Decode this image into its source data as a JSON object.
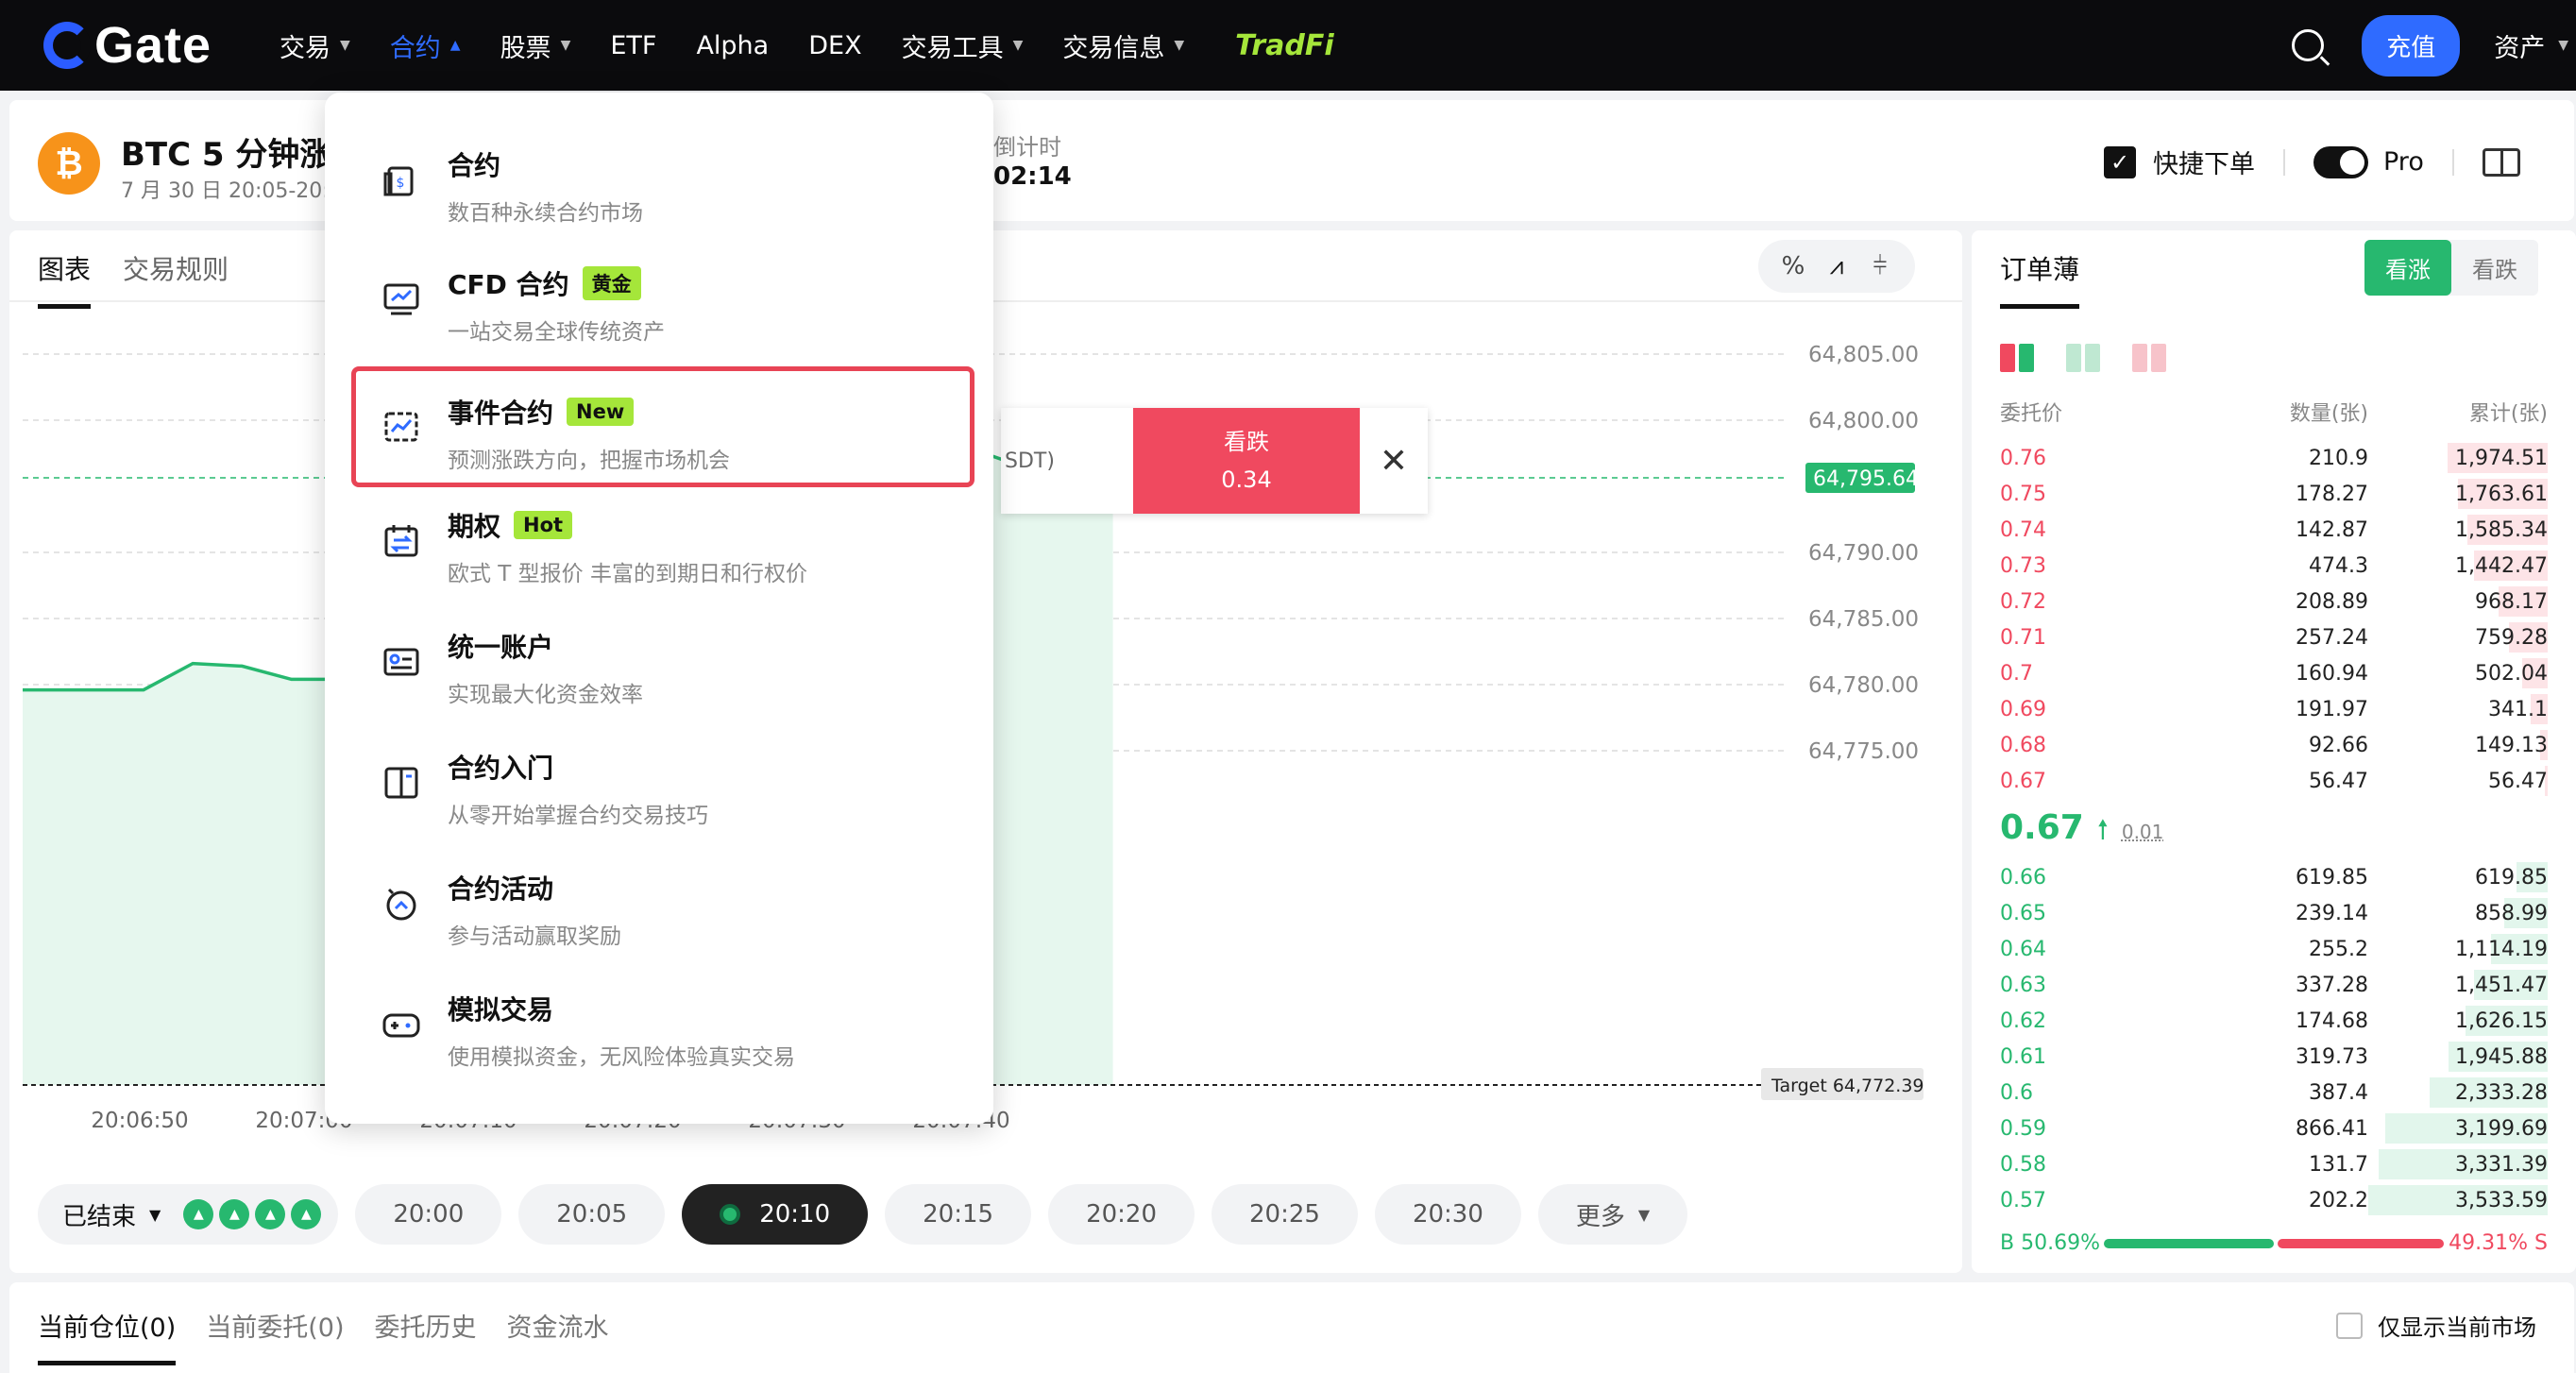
{
  "nav": {
    "logo": "Gate",
    "items": [
      {
        "label": "交易",
        "caret": true,
        "active": false
      },
      {
        "label": "合约",
        "caret": true,
        "active": true
      },
      {
        "label": "股票",
        "caret": true,
        "active": false
      },
      {
        "label": "ETF",
        "caret": false,
        "active": false
      },
      {
        "label": "Alpha",
        "caret": false,
        "active": false
      },
      {
        "label": "DEX",
        "caret": false,
        "active": false
      },
      {
        "label": "交易工具",
        "caret": true,
        "active": false
      },
      {
        "label": "交易信息",
        "caret": true,
        "active": false
      }
    ],
    "tradfi": "TradFi",
    "deposit": "充值",
    "assets": "资产"
  },
  "header": {
    "title": "BTC 5 分钟涨",
    "subtitle": "7 月 30 日 20:05-20:",
    "countdown_label": "倒计时",
    "countdown_value": "02:14",
    "quick_order": "快捷下单",
    "pro": "Pro"
  },
  "chart_panel": {
    "tabs": [
      "图表",
      "交易规则"
    ],
    "popup": {
      "left_text": "SDT)",
      "sell_label": "看跌",
      "sell_value": "0.34"
    },
    "y_ticks": [
      "64,805.00",
      "64,800.00",
      "64,795.64",
      "64,790.00",
      "64,785.00",
      "64,780.00",
      "64,775.00"
    ],
    "target_label": "Target 64,772.39",
    "x_ticks": [
      "20:06:50",
      "20:07:00",
      "20:07:10",
      "20:07:20",
      "20:07:30",
      "20:07:40"
    ],
    "ended_label": "已结束",
    "rounds": [
      "20:00",
      "20:05",
      "20:10",
      "20:15",
      "20:20",
      "20:25",
      "20:30"
    ],
    "active_round": "20:10",
    "more": "更多"
  },
  "chart_data": {
    "type": "area",
    "x": [
      "20:06:44",
      "20:06:50",
      "20:06:53",
      "20:06:56",
      "20:06:59",
      "20:07:02",
      "20:07:05",
      "20:07:08",
      "20:07:11",
      "20:07:14",
      "20:07:17",
      "20:07:20",
      "20:07:22",
      "20:07:25",
      "20:07:28",
      "20:07:31",
      "20:07:34",
      "20:07:37",
      "20:07:40",
      "20:07:43",
      "20:07:46",
      "20:07:49"
    ],
    "values": [
      64779.6,
      64779.6,
      64781.6,
      64781.4,
      64780.4,
      64780.4,
      64781.0,
      64782.0,
      64786.0,
      64792.0,
      64795.6,
      64795.6,
      64791.0,
      64790.2,
      64796.5,
      64797.0,
      64796.9,
      64797.2,
      64798.0,
      64796.7,
      64796.3,
      64795.64
    ],
    "current": 64795.64,
    "target": 64772.39,
    "ylim": [
      64771.5,
      64806.5
    ]
  },
  "dropdown": [
    {
      "icon": "futures-icon",
      "title": "合约",
      "badge": "",
      "desc": "数百种永续合约市场"
    },
    {
      "icon": "cfd-icon",
      "title": "CFD 合约",
      "badge": "黄金",
      "desc": "一站交易全球传统资产"
    },
    {
      "icon": "event-icon",
      "title": "事件合约",
      "badge": "New",
      "desc": "预测涨跌方向，把握市场机会"
    },
    {
      "icon": "options-icon",
      "title": "期权",
      "badge": "Hot",
      "desc": "欧式 T 型报价 丰富的到期日和行权价"
    },
    {
      "icon": "account-icon",
      "title": "统一账户",
      "badge": "",
      "desc": "实现最大化资金效率"
    },
    {
      "icon": "book-open-icon",
      "title": "合约入门",
      "badge": "",
      "desc": "从零开始掌握合约交易技巧"
    },
    {
      "icon": "activity-icon",
      "title": "合约活动",
      "badge": "",
      "desc": "参与活动赢取奖励"
    },
    {
      "icon": "gamepad-icon",
      "title": "模拟交易",
      "badge": "",
      "desc": "使用模拟资金，无风险体验真实交易"
    }
  ],
  "orderbook": {
    "title": "订单薄",
    "up": "看涨",
    "down": "看跌",
    "headers": [
      "委托价",
      "数量(张)",
      "累计(张)"
    ],
    "asks": [
      {
        "p": "0.76",
        "q": "210.9",
        "t": "1,974.51",
        "f": 0.559
      },
      {
        "p": "0.75",
        "q": "178.27",
        "t": "1,763.61",
        "f": 0.499
      },
      {
        "p": "0.74",
        "q": "142.87",
        "t": "1,585.34",
        "f": 0.449
      },
      {
        "p": "0.73",
        "q": "474.3",
        "t": "1,442.47",
        "f": 0.408
      },
      {
        "p": "0.72",
        "q": "208.89",
        "t": "968.17",
        "f": 0.274
      },
      {
        "p": "0.71",
        "q": "257.24",
        "t": "759.28",
        "f": 0.215
      },
      {
        "p": "0.7",
        "q": "160.94",
        "t": "502.04",
        "f": 0.142
      },
      {
        "p": "0.69",
        "q": "191.97",
        "t": "341.1",
        "f": 0.097
      },
      {
        "p": "0.68",
        "q": "92.66",
        "t": "149.13",
        "f": 0.042
      },
      {
        "p": "0.67",
        "q": "56.47",
        "t": "56.47",
        "f": 0.016
      }
    ],
    "mid_price": "0.67",
    "mid_step": "0.01",
    "bids": [
      {
        "p": "0.66",
        "q": "619.85",
        "t": "619.85",
        "f": 0.175
      },
      {
        "p": "0.65",
        "q": "239.14",
        "t": "858.99",
        "f": 0.243
      },
      {
        "p": "0.64",
        "q": "255.2",
        "t": "1,114.19",
        "f": 0.315
      },
      {
        "p": "0.63",
        "q": "337.28",
        "t": "1,451.47",
        "f": 0.411
      },
      {
        "p": "0.62",
        "q": "174.68",
        "t": "1,626.15",
        "f": 0.46
      },
      {
        "p": "0.61",
        "q": "319.73",
        "t": "1,945.88",
        "f": 0.551
      },
      {
        "p": "0.6",
        "q": "387.4",
        "t": "2,333.28",
        "f": 0.66
      },
      {
        "p": "0.59",
        "q": "866.41",
        "t": "3,199.69",
        "f": 0.906
      },
      {
        "p": "0.58",
        "q": "131.7",
        "t": "3,331.39",
        "f": 0.943
      },
      {
        "p": "0.57",
        "q": "202.2",
        "t": "3,533.59",
        "f": 1.0
      }
    ],
    "ratio_b": "B 50.69%",
    "ratio_s": "49.31% S",
    "ratio_b_value": 50.69
  },
  "bottom": {
    "tabs": [
      "当前仓位(0)",
      "当前委托(0)",
      "委托历史",
      "资金流水"
    ],
    "only_current": "仅显示当前市场"
  }
}
